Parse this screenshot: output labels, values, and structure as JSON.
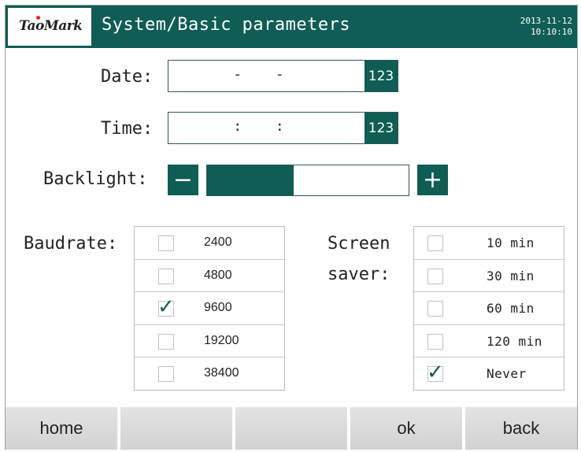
{
  "header": {
    "logo_text": "TaoMark",
    "title": "System/Basic parameters",
    "date": "2013-11-12",
    "time": "10:10:10"
  },
  "date_field": {
    "label": "Date:",
    "value": "- -",
    "button": "123"
  },
  "time_field": {
    "label": "Time:",
    "value": ": :",
    "button": "123"
  },
  "backlight": {
    "label": "Backlight:",
    "minus": "−",
    "plus": "+",
    "level_fraction": 0.43
  },
  "baudrate": {
    "label": "Baudrate:",
    "options": [
      {
        "label": "2400",
        "checked": false
      },
      {
        "label": "4800",
        "checked": false
      },
      {
        "label": "9600",
        "checked": true
      },
      {
        "label": "19200",
        "checked": false
      },
      {
        "label": "38400",
        "checked": false
      }
    ]
  },
  "screensaver": {
    "label_line1": "Screen",
    "label_line2": "saver:",
    "options": [
      {
        "label": "10 min",
        "checked": false
      },
      {
        "label": "30 min",
        "checked": false
      },
      {
        "label": "60 min",
        "checked": false
      },
      {
        "label": "120 min",
        "checked": false
      },
      {
        "label": "Never",
        "checked": true
      }
    ]
  },
  "check_glyph": "✓",
  "bottom_buttons": [
    "home",
    "",
    "",
    "ok",
    "back"
  ],
  "colors": {
    "accent": "#0f5d55",
    "button_bg": "#d9d9d9"
  }
}
